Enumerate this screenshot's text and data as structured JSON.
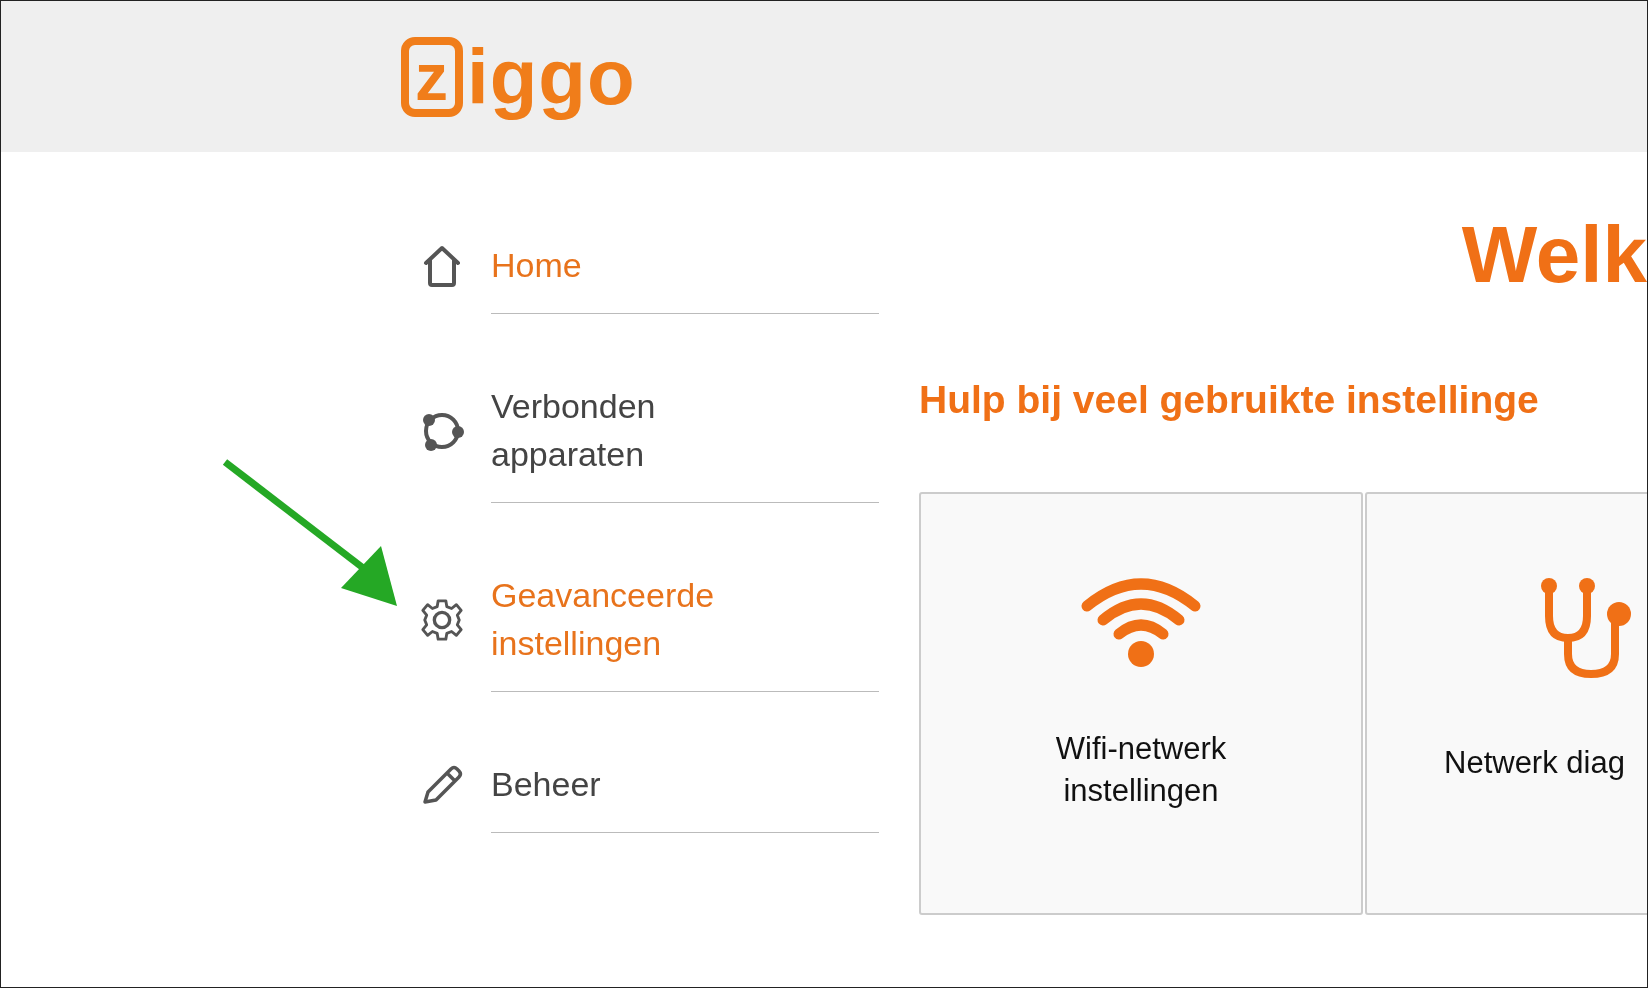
{
  "header": {
    "logo": "ziggo"
  },
  "sidebar": {
    "items": [
      {
        "label": "Home",
        "highlighted": true
      },
      {
        "label": "Verbonden apparaten",
        "highlighted": false
      },
      {
        "label": "Geavanceerde instellingen",
        "highlighted": true
      },
      {
        "label": "Beheer",
        "highlighted": false
      }
    ]
  },
  "main": {
    "title": "Welk",
    "subtitle": "Hulp bij veel gebruikte instellinge",
    "cards": [
      {
        "label": "Wifi-netwerk instellingen"
      },
      {
        "label": "Netwerk diag"
      }
    ]
  }
}
